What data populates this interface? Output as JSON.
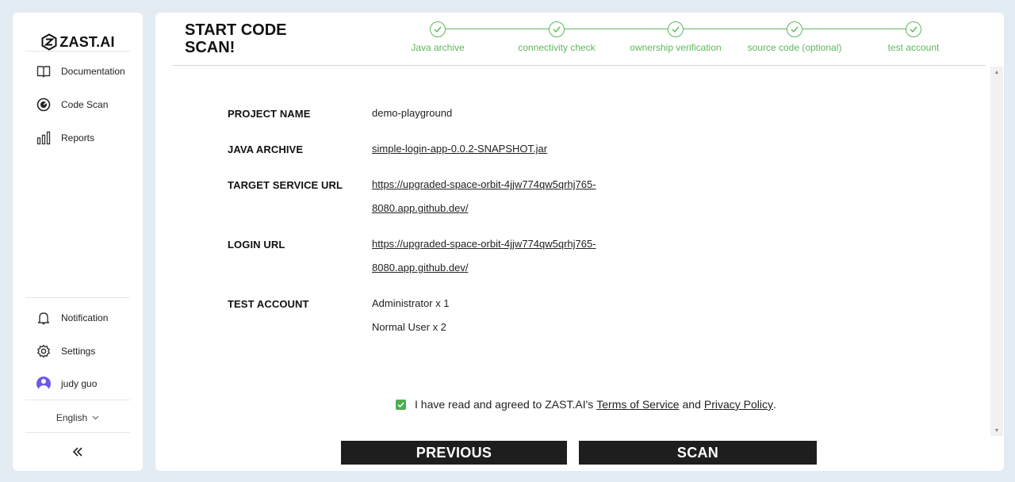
{
  "brand": {
    "logo_text": "ZAST.AI"
  },
  "sidebar": {
    "nav": [
      {
        "label": "Documentation",
        "icon": "book-icon"
      },
      {
        "label": "Code Scan",
        "icon": "scan-icon"
      },
      {
        "label": "Reports",
        "icon": "bar-chart-icon"
      }
    ],
    "bottom": [
      {
        "label": "Notification",
        "icon": "bell-icon"
      },
      {
        "label": "Settings",
        "icon": "gear-icon"
      },
      {
        "label": "judy guo",
        "icon": "avatar"
      }
    ],
    "language": "English"
  },
  "main": {
    "title": "START CODE SCAN!",
    "steps": [
      {
        "label": "Java archive",
        "done": true
      },
      {
        "label": "connectivity check",
        "done": true
      },
      {
        "label": "ownership verification",
        "done": true
      },
      {
        "label": "source code (optional)",
        "done": true
      },
      {
        "label": "test account",
        "done": true
      }
    ],
    "summary": {
      "project_name": {
        "label": "PROJECT NAME",
        "value": "demo-playground"
      },
      "java_archive": {
        "label": "JAVA ARCHIVE",
        "value": "simple-login-app-0.0.2-SNAPSHOT.jar"
      },
      "target_url": {
        "label": "TARGET SERVICE URL",
        "line1": "https://upgraded-space-orbit-4jjw774qw5qrhj765-",
        "line2": "8080.app.github.dev/"
      },
      "login_url": {
        "label": "LOGIN URL",
        "line1": "https://upgraded-space-orbit-4jjw774qw5qrhj765-",
        "line2": "8080.app.github.dev/"
      },
      "test_account": {
        "label": "TEST ACCOUNT",
        "line1": "Administrator x 1",
        "line2": "Normal User x 2"
      }
    },
    "agreement": {
      "checked": true,
      "prefix": "I have read and agreed to ZAST.AI's",
      "terms": "Terms of Service",
      "and": "and",
      "privacy": "Privacy Policy",
      "suffix": "."
    },
    "buttons": {
      "previous": "PREVIOUS",
      "scan": "SCAN"
    }
  },
  "colors": {
    "accent_green": "#5cb85c",
    "button_dark": "#1e1e1e",
    "background": "#e3ebf3"
  }
}
